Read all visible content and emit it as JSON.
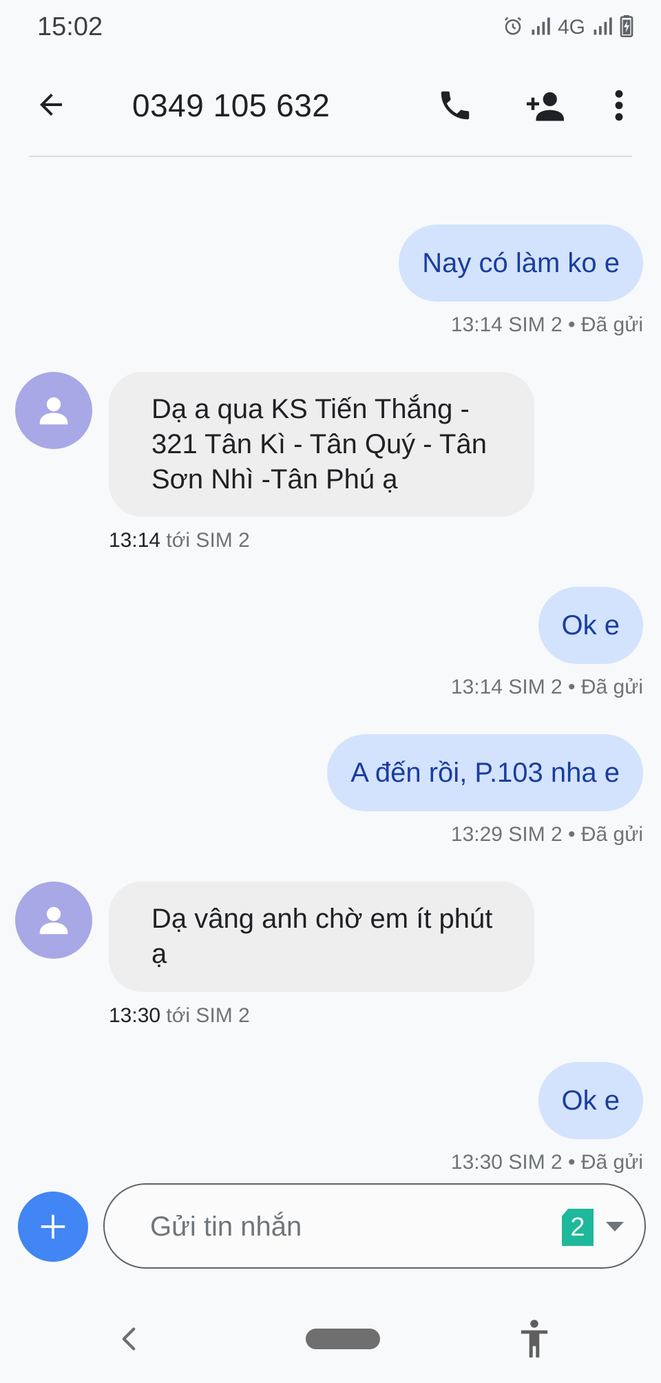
{
  "status_bar": {
    "time": "15:02",
    "network_label": "4G",
    "icons": [
      "alarm-icon",
      "signal-icon",
      "signal-icon",
      "battery-charging-icon"
    ]
  },
  "header": {
    "title": "0349 105 632",
    "icons": [
      "arrow-back-icon",
      "phone-icon",
      "add-contact-icon",
      "more-vert-icon"
    ]
  },
  "messages": [
    {
      "direction": "sent",
      "text": "Nay có làm ko e",
      "time": "13:14",
      "meta": "SIM 2 • Đã gửi"
    },
    {
      "direction": "received",
      "text": "Dạ a qua KS Tiến Thắng - 321 Tân Kì - Tân Quý - Tân Sơn Nhì -Tân Phú ạ",
      "time": "13:14",
      "meta": "tới SIM 2"
    },
    {
      "direction": "sent",
      "text": "Ok e",
      "time": "13:14",
      "meta": "SIM 2 • Đã gửi"
    },
    {
      "direction": "sent",
      "text": "A đến rồi, P.103 nha e",
      "time": "13:29",
      "meta": "SIM 2 • Đã gửi"
    },
    {
      "direction": "received",
      "text": "Dạ vâng anh chờ em ít phút ạ",
      "time": "13:30",
      "meta": "tới SIM 2"
    },
    {
      "direction": "sent",
      "text": "Ok e",
      "time": "13:30",
      "meta": "SIM 2 • Đã gửi"
    }
  ],
  "compose": {
    "placeholder": "Gửi tin nhắn",
    "value": "",
    "sim_number": "2"
  },
  "colors": {
    "sent_bubble": "#d3e3fd",
    "sent_text": "#1a3d9e",
    "received_bubble": "#eeeeee",
    "avatar": "#a8a8e6",
    "fab": "#4285f4",
    "sim_badge": "#1db99a"
  }
}
